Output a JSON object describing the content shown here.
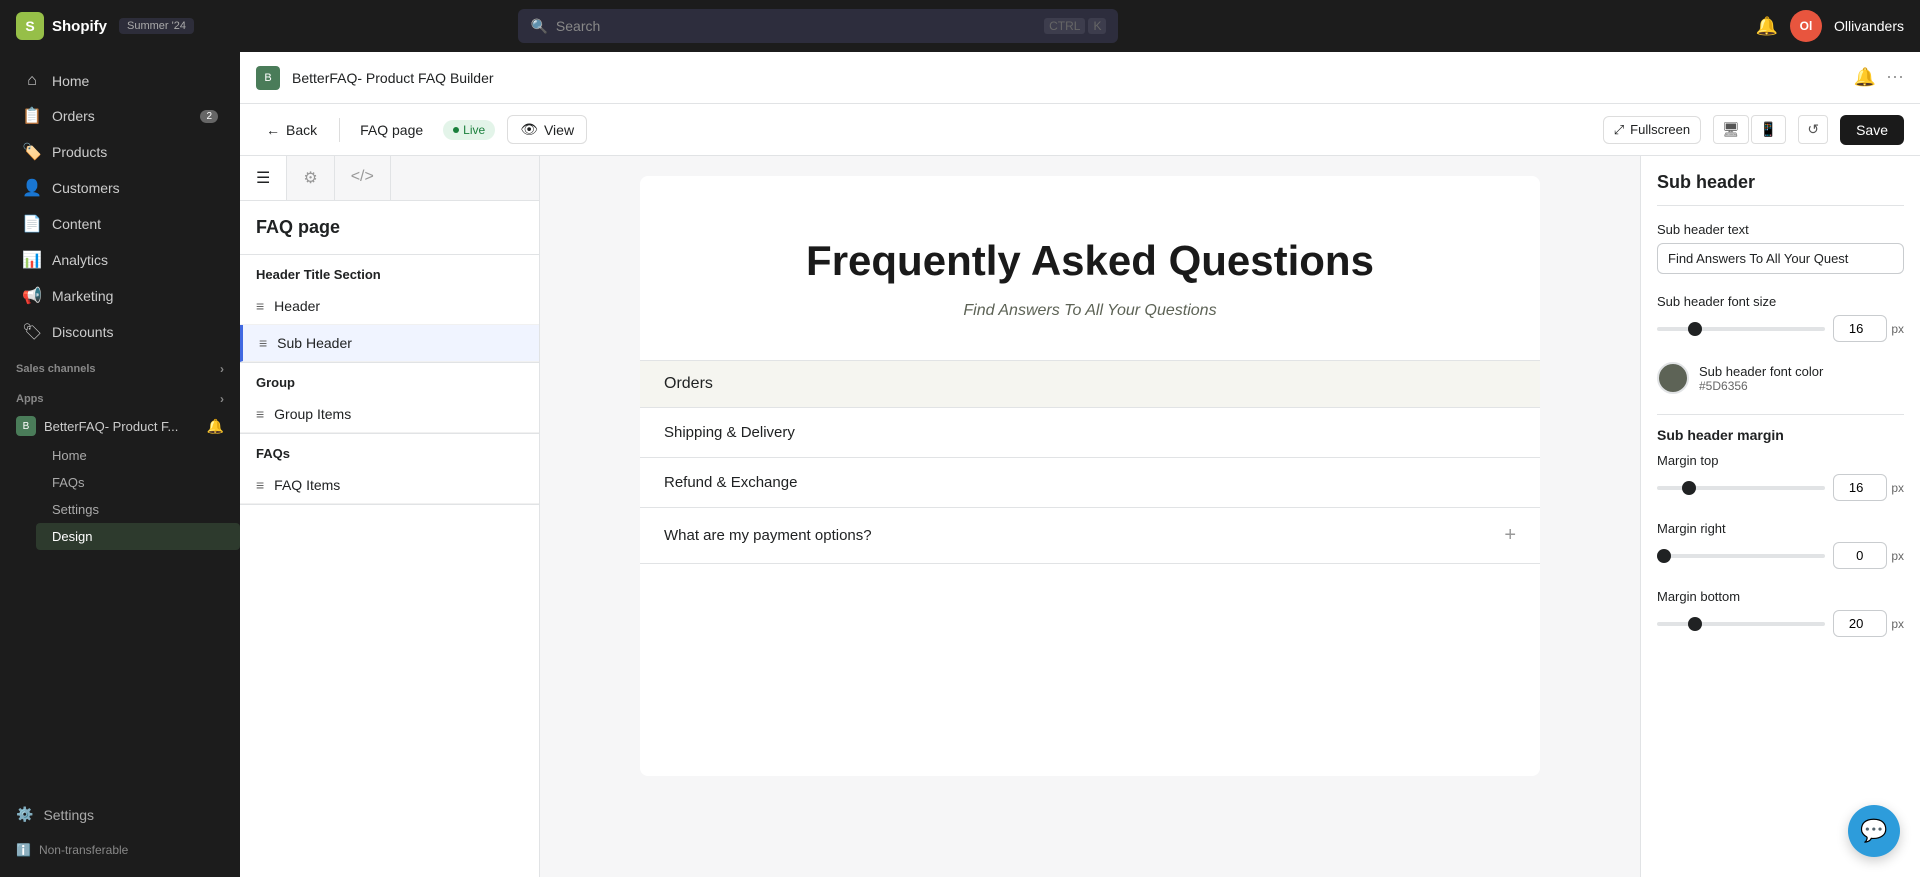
{
  "topNav": {
    "logoText": "S",
    "shopifyLabel": "Shopify",
    "badgeLabel": "Summer '24",
    "searchPlaceholder": "Search",
    "shortcutCtrl": "CTRL",
    "shortcutK": "K",
    "avatarInitials": "Ol",
    "storeName": "Ollivanders"
  },
  "sidebar": {
    "items": [
      {
        "id": "home",
        "label": "Home",
        "icon": "⌂"
      },
      {
        "id": "orders",
        "label": "Orders",
        "icon": "📋",
        "badge": "2"
      },
      {
        "id": "products",
        "label": "Products",
        "icon": "🏷️"
      },
      {
        "id": "customers",
        "label": "Customers",
        "icon": "👤"
      },
      {
        "id": "content",
        "label": "Content",
        "icon": "📄"
      },
      {
        "id": "analytics",
        "label": "Analytics",
        "icon": "📊"
      },
      {
        "id": "marketing",
        "label": "Marketing",
        "icon": "📢"
      },
      {
        "id": "discounts",
        "label": "Discounts",
        "icon": "🏷"
      }
    ],
    "salesChannelsLabel": "Sales channels",
    "appsLabel": "Apps",
    "appName": "BetterFAQ- Product F...",
    "appSubItems": [
      {
        "id": "home",
        "label": "Home"
      },
      {
        "id": "faqs",
        "label": "FAQs"
      },
      {
        "id": "settings",
        "label": "Settings"
      },
      {
        "id": "design",
        "label": "Design",
        "active": true
      }
    ],
    "settingsLabel": "Settings",
    "nonTransferableLabel": "Non-transferable"
  },
  "appHeader": {
    "iconText": "B",
    "title": "BetterFAQ- Product FAQ Builder"
  },
  "subHeader": {
    "backLabel": "Back",
    "tabLabel": "FAQ page",
    "liveLabel": "Live",
    "viewLabel": "View",
    "fullscreenLabel": "Fullscreen",
    "saveLabel": "Save"
  },
  "leftPanel": {
    "title": "FAQ page",
    "sections": [
      {
        "label": "Header Title Section",
        "items": [
          {
            "id": "header",
            "label": "Header"
          },
          {
            "id": "sub-header",
            "label": "Sub Header",
            "active": true
          }
        ]
      },
      {
        "label": "Group",
        "items": [
          {
            "id": "group-items",
            "label": "Group Items"
          }
        ]
      },
      {
        "label": "FAQs",
        "items": [
          {
            "id": "faq-items",
            "label": "FAQ Items"
          }
        ]
      }
    ]
  },
  "preview": {
    "mainTitle": "Frequently Asked Questions",
    "subtitle": "Find Answers To All Your Questions",
    "groups": [
      {
        "label": "Orders",
        "items": [
          {
            "label": "Shipping & Delivery"
          },
          {
            "label": "Refund & Exchange"
          }
        ]
      }
    ],
    "faqItems": [
      {
        "label": "What are my payment options?"
      }
    ]
  },
  "rightPanel": {
    "title": "Sub header",
    "textLabel": "Sub header text",
    "textValue": "Find Answers To All Your Quest",
    "fontSizeLabel": "Sub header font size",
    "fontSize": 16,
    "fontColorLabel": "Sub header font color",
    "fontColorHex": "#5D6356",
    "fontColorName": "Sub header font color",
    "marginTitle": "Sub header margin",
    "marginTopLabel": "Margin top",
    "marginTopValue": 16,
    "marginRightLabel": "Margin right",
    "marginRightValue": 0,
    "marginBottomLabel": "Margin bottom",
    "marginBottomValue": 20
  }
}
